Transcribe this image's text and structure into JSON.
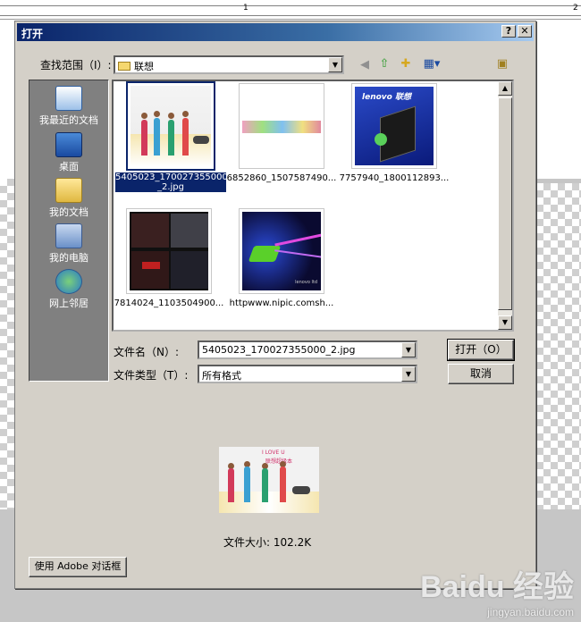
{
  "ruler": {
    "marks": [
      "1",
      "2"
    ]
  },
  "dialog": {
    "title": "打开",
    "help_label": "?",
    "close_label": "✕",
    "look_in_label": "查找范围（I）:",
    "look_in_value": "联想",
    "places": [
      {
        "label": "我最近的文档",
        "icon": "recent-docs-icon"
      },
      {
        "label": "桌面",
        "icon": "desktop-icon"
      },
      {
        "label": "我的文档",
        "icon": "my-documents-icon"
      },
      {
        "label": "我的电脑",
        "icon": "my-computer-icon"
      },
      {
        "label": "网上邻居",
        "icon": "network-icon"
      }
    ],
    "files": [
      {
        "caption": "5405023_170027355000_2.jpg",
        "caption_line1": "5405023_170027355000",
        "caption_line2": "_2.jpg",
        "selected": true
      },
      {
        "caption": "6852860_1507587490..."
      },
      {
        "caption": "7757940_1800112893..."
      },
      {
        "caption": "7814024_1103504900..."
      },
      {
        "caption": "httpwww.nipic.comsh..."
      }
    ],
    "filename_label": "文件名（N）:",
    "filename_value": "5405023_170027355000_2.jpg",
    "filetype_label": "文件类型（T）:",
    "filetype_value": "所有格式",
    "open_button": "打开（O）",
    "cancel_button": "取消",
    "preview_text_1": "I LOVE U",
    "preview_text_2": "联想超级本",
    "filesize_text": "文件大小: 102.2K",
    "adobe_button": "使用 Adobe 对话框",
    "thumb_lenovo_brand": "lenovo 联想",
    "thumb_lenovo_tag": "lenovo ltd"
  },
  "watermark": {
    "main": "Baidu 经验",
    "sub": "jingyan.baidu.com"
  },
  "colors": {
    "titlebar_start": "#0a246a",
    "selection": "#0a246a",
    "dialog_bg": "#d4d0c8"
  }
}
